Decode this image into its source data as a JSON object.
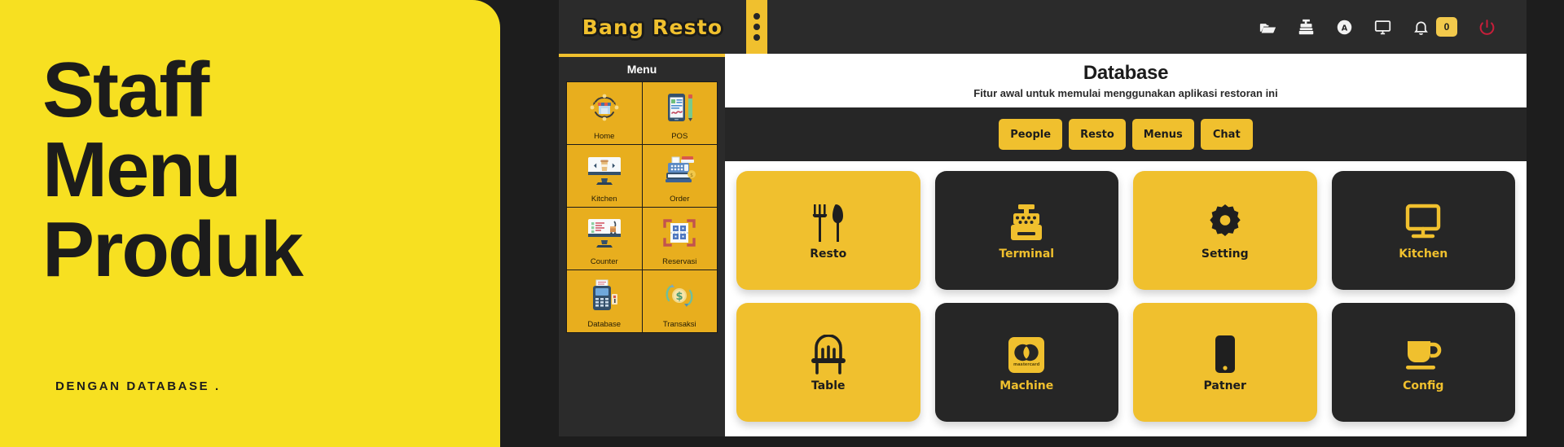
{
  "poster": {
    "line1": "Staff",
    "line2": "Menu",
    "line3": "Produk",
    "subtitle": "DENGAN DATABASE .",
    "bg_color": "#F7E021",
    "text_color": "#1C1C1C"
  },
  "app": {
    "brand": "Bang Resto",
    "menu_toggle_icon": "three-dots-vertical-icon",
    "toolbar": [
      {
        "icon": "folder-open-icon",
        "label": ""
      },
      {
        "icon": "cash-register-icon",
        "label": ""
      },
      {
        "icon": "angular-logo-icon",
        "label": ""
      },
      {
        "icon": "monitor-icon",
        "label": ""
      },
      {
        "icon": "bell-icon",
        "label": ""
      }
    ],
    "notification_badge": "0",
    "power_icon": "power-icon",
    "power_color": "#C81E3A"
  },
  "sidebar": {
    "title": "Menu",
    "items": [
      {
        "label": "Home",
        "icon": "store-refresh-icon"
      },
      {
        "label": "POS",
        "icon": "mobile-signature-icon"
      },
      {
        "label": "Kitchen",
        "icon": "monitor-coffee-icon"
      },
      {
        "label": "Order",
        "icon": "cash-register-receipt-icon"
      },
      {
        "label": "Counter",
        "icon": "monitor-checklist-icon"
      },
      {
        "label": "Reservasi",
        "icon": "qr-scan-icon"
      },
      {
        "label": "Database",
        "icon": "card-terminal-icon"
      },
      {
        "label": "Transaksi",
        "icon": "dollar-refresh-icon"
      }
    ]
  },
  "main": {
    "title": "Database",
    "subtitle": "Fitur awal untuk memulai menggunakan aplikasi restoran ini",
    "tabs": [
      {
        "label": "People"
      },
      {
        "label": "Resto"
      },
      {
        "label": "Menus"
      },
      {
        "label": "Chat"
      }
    ],
    "cards": [
      {
        "label": "Resto",
        "icon": "fork-knife-icon",
        "style": "yellow"
      },
      {
        "label": "Terminal",
        "icon": "cash-register-icon",
        "style": "dark"
      },
      {
        "label": "Setting",
        "icon": "gear-icon",
        "style": "yellow"
      },
      {
        "label": "Kitchen",
        "icon": "monitor-icon",
        "style": "dark"
      },
      {
        "label": "Table",
        "icon": "chair-icon",
        "style": "yellow"
      },
      {
        "label": "Machine",
        "icon": "mastercard-icon",
        "style": "dark",
        "sub": "mastercard"
      },
      {
        "label": "Patner",
        "icon": "smartphone-icon",
        "style": "yellow"
      },
      {
        "label": "Config",
        "icon": "coffee-cup-icon",
        "style": "dark"
      }
    ]
  },
  "colors": {
    "accent_yellow": "#F0C02E",
    "poster_yellow": "#F7E021",
    "dark": "#262626",
    "panel_dark": "#2B2B2B",
    "sidebar_tile": "#E8AE1E"
  }
}
